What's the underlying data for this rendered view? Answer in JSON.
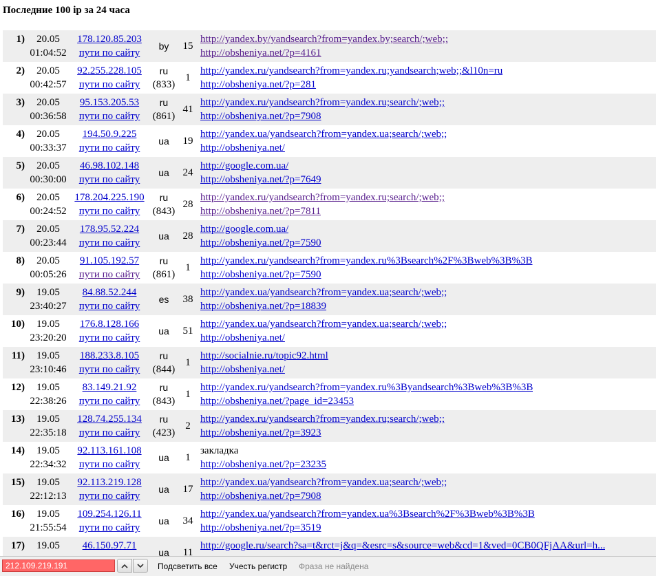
{
  "page": {
    "title": "Последние 100 ip за 24 часа"
  },
  "rows": [
    {
      "num": "1)",
      "date": "20.05",
      "time": "01:04:52",
      "ip": "178.120.85.203",
      "paths": "пути по сайту",
      "country": "by",
      "country_num": "",
      "hits": "15",
      "referer": "http://yandex.by/yandsearch?from=yandex.by;search/;web;;",
      "page_url": "http://obsheniya.net/?p=4161"
    },
    {
      "num": "2)",
      "date": "20.05",
      "time": "00:42:57",
      "ip": "92.255.228.105",
      "paths": "пути по сайту",
      "country": "ru",
      "country_num": "(833)",
      "hits": "1",
      "referer": "http://yandex.ru/yandsearch?from=yandex.ru;yandsearch;web;;&l10n=ru",
      "page_url": "http://obsheniya.net/?p=281"
    },
    {
      "num": "3)",
      "date": "20.05",
      "time": "00:36:58",
      "ip": "95.153.205.53",
      "paths": "пути по сайту",
      "country": "ru",
      "country_num": "(861)",
      "hits": "41",
      "referer": "http://yandex.ru/yandsearch?from=yandex.ru;search/;web;;",
      "page_url": "http://obsheniya.net/?p=7908"
    },
    {
      "num": "4)",
      "date": "20.05",
      "time": "00:33:37",
      "ip": "194.50.9.225",
      "paths": "пути по сайту",
      "country": "ua",
      "country_num": "",
      "hits": "19",
      "referer": "http://yandex.ua/yandsearch?from=yandex.ua;search/;web;;",
      "page_url": "http://obsheniya.net/"
    },
    {
      "num": "5)",
      "date": "20.05",
      "time": "00:30:00",
      "ip": "46.98.102.148",
      "paths": "пути по сайту",
      "country": "ua",
      "country_num": "",
      "hits": "24",
      "referer": "http://google.com.ua/",
      "page_url": "http://obsheniya.net/?p=7649"
    },
    {
      "num": "6)",
      "date": "20.05",
      "time": "00:24:52",
      "ip": "178.204.225.190",
      "paths": "пути по сайту",
      "country": "ru",
      "country_num": "(843)",
      "hits": "28",
      "referer": "http://yandex.ru/yandsearch?from=yandex.ru;search/;web;;",
      "page_url": "http://obsheniya.net/?p=7811"
    },
    {
      "num": "7)",
      "date": "20.05",
      "time": "00:23:44",
      "ip": "178.95.52.224",
      "paths": "пути по сайту",
      "country": "ua",
      "country_num": "",
      "hits": "28",
      "referer": "http://google.com.ua/",
      "page_url": "http://obsheniya.net/?p=7590"
    },
    {
      "num": "8)",
      "date": "20.05",
      "time": "00:05:26",
      "ip": "91.105.192.57",
      "paths": "пути по сайту",
      "country": "ru",
      "country_num": "(861)",
      "hits": "1",
      "referer": "http://yandex.ru/yandsearch?from=yandex.ru%3Bsearch%2F%3Bweb%3B%3B",
      "page_url": "http://obsheniya.net/?p=7590"
    },
    {
      "num": "9)",
      "date": "19.05",
      "time": "23:40:27",
      "ip": "84.88.52.244",
      "paths": "пути по сайту",
      "country": "es",
      "country_num": "",
      "hits": "38",
      "referer": "http://yandex.ua/yandsearch?from=yandex.ua;search/;web;;",
      "page_url": "http://obsheniya.net/?p=18839"
    },
    {
      "num": "10)",
      "date": "19.05",
      "time": "23:20:20",
      "ip": "176.8.128.166",
      "paths": "пути по сайту",
      "country": "ua",
      "country_num": "",
      "hits": "51",
      "referer": "http://yandex.ua/yandsearch?from=yandex.ua;search/;web;;",
      "page_url": "http://obsheniya.net/"
    },
    {
      "num": "11)",
      "date": "19.05",
      "time": "23:10:46",
      "ip": "188.233.8.105",
      "paths": "пути по сайту",
      "country": "ru",
      "country_num": "(844)",
      "hits": "1",
      "referer": "http://socialnie.ru/topic92.html",
      "page_url": "http://obsheniya.net/"
    },
    {
      "num": "12)",
      "date": "19.05",
      "time": "22:38:26",
      "ip": "83.149.21.92",
      "paths": "пути по сайту",
      "country": "ru",
      "country_num": "(843)",
      "hits": "1",
      "referer": "http://yandex.ru/yandsearch?from=yandex.ru%3Byandsearch%3Bweb%3B%3B",
      "page_url": "http://obsheniya.net/?page_id=23453"
    },
    {
      "num": "13)",
      "date": "19.05",
      "time": "22:35:18",
      "ip": "128.74.255.134",
      "paths": "пути по сайту",
      "country": "ru",
      "country_num": "(423)",
      "hits": "2",
      "referer": "http://yandex.ru/yandsearch?from=yandex.ru;search/;web;;",
      "page_url": "http://obsheniya.net/?p=3923"
    },
    {
      "num": "14)",
      "date": "19.05",
      "time": "22:34:32",
      "ip": "92.113.161.108",
      "paths": "пути по сайту",
      "country": "ua",
      "country_num": "",
      "hits": "1",
      "referer": "закладка",
      "page_url": "http://obsheniya.net/?p=23235"
    },
    {
      "num": "15)",
      "date": "19.05",
      "time": "22:12:13",
      "ip": "92.113.219.128",
      "paths": "пути по сайту",
      "country": "ua",
      "country_num": "",
      "hits": "17",
      "referer": "http://yandex.ua/yandsearch?from=yandex.ua;search/;web;;",
      "page_url": "http://obsheniya.net/?p=7908"
    },
    {
      "num": "16)",
      "date": "19.05",
      "time": "21:55:54",
      "ip": "109.254.126.11",
      "paths": "пути по сайту",
      "country": "ua",
      "country_num": "",
      "hits": "34",
      "referer": "http://yandex.ua/yandsearch?from=yandex.ua%3Bsearch%2F%3Bweb%3B%3B",
      "page_url": "http://obsheniya.net/?p=3519"
    },
    {
      "num": "17)",
      "date": "19.05",
      "time": "",
      "ip": "46.150.97.71",
      "paths": "",
      "country": "ua",
      "country_num": "",
      "hits": "11",
      "referer": "http://google.ru/search?sa=t&rct=j&q=&esrc=s&source=web&cd=1&ved=0CB0QFjAA&url=h...",
      "page_url": ""
    }
  ],
  "find_bar": {
    "query": "212.109.219.191",
    "prev_icon": "chevron-up-icon",
    "next_icon": "chevron-down-icon",
    "highlight_all": "Подсветить все",
    "match_case": "Учесть регистр",
    "status": "Фраза не найдена",
    "colors": {
      "not_found_bg": "#ff6666",
      "status_text": "#888888"
    }
  },
  "colors": {
    "link": "#0000cc",
    "visited_link": "#551a8b",
    "row_alt_bg": "#eeeeee"
  }
}
